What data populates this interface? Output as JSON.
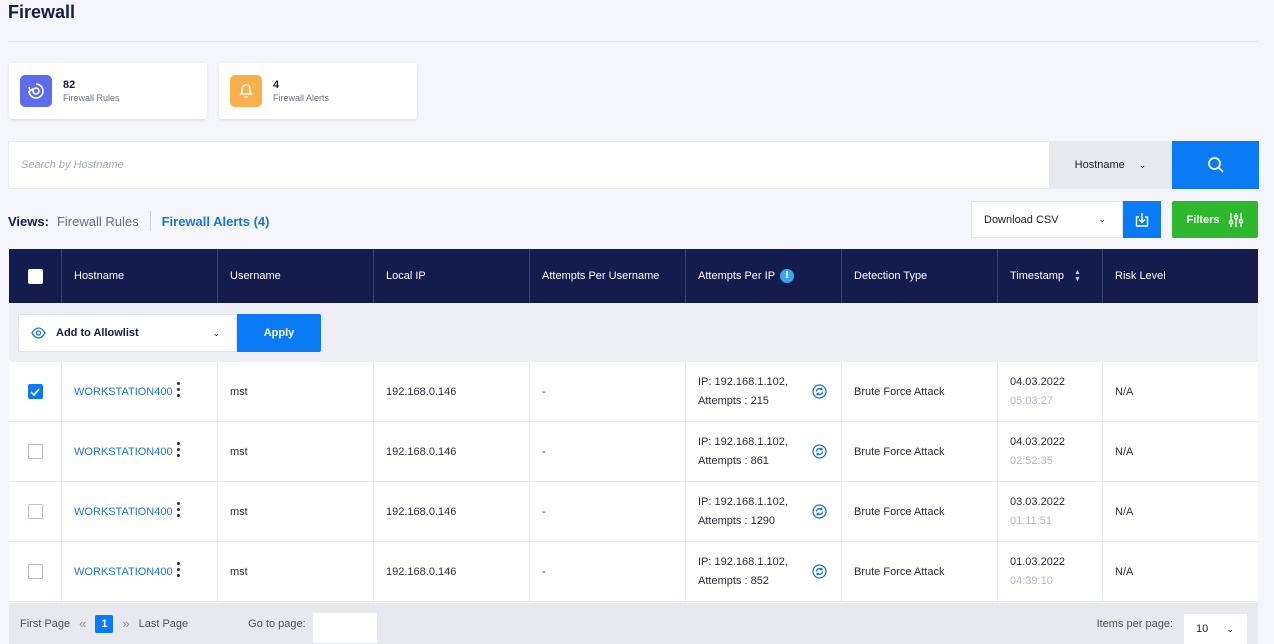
{
  "page": {
    "title": "Firewall"
  },
  "stats": [
    {
      "count": "82",
      "label": "Firewall Rules",
      "icon": "target-icon",
      "color": "#5f6ce9"
    },
    {
      "count": "4",
      "label": "Firewall Alerts",
      "icon": "bell-icon",
      "color": "#f9b04c"
    }
  ],
  "search": {
    "placeholder": "Search by Hostname",
    "field": "Hostname"
  },
  "views": {
    "label": "Views:",
    "tabs": [
      "Firewall Rules",
      "Firewall Alerts (4)"
    ],
    "active": 1
  },
  "toolbar": {
    "download_label": "Download CSV",
    "filters_label": "Filters"
  },
  "table": {
    "columns": [
      "Hostname",
      "Username",
      "Local IP",
      "Attempts Per Username",
      "Attempts Per IP",
      "Detection Type",
      "Timestamp",
      "Risk Level"
    ],
    "bulk_action": "Add to Allowlist",
    "apply_label": "Apply",
    "rows": [
      {
        "checked": true,
        "hostname": "WORKSTATION400",
        "username": "mst",
        "local_ip": "192.168.0.146",
        "attempts_user": "-",
        "ip_line": "IP: 192.168.1.102,",
        "attempts_line": "Attempts : 215",
        "detection": "Brute Force Attack",
        "date": "04.03.2022",
        "time": "05:03:27",
        "risk": "N/A"
      },
      {
        "checked": false,
        "hostname": "WORKSTATION400",
        "username": "mst",
        "local_ip": "192.168.0.146",
        "attempts_user": "-",
        "ip_line": "IP: 192.168.1.102,",
        "attempts_line": "Attempts : 861",
        "detection": "Brute Force Attack",
        "date": "04.03.2022",
        "time": "02:52:35",
        "risk": "N/A"
      },
      {
        "checked": false,
        "hostname": "WORKSTATION400",
        "username": "mst",
        "local_ip": "192.168.0.146",
        "attempts_user": "-",
        "ip_line": "IP: 192.168.1.102,",
        "attempts_line": "Attempts : 1290",
        "detection": "Brute Force Attack",
        "date": "03.03.2022",
        "time": "01:11:51",
        "risk": "N/A"
      },
      {
        "checked": false,
        "hostname": "WORKSTATION400",
        "username": "mst",
        "local_ip": "192.168.0.146",
        "attempts_user": "-",
        "ip_line": "IP: 192.168.1.102,",
        "attempts_line": "Attempts : 852",
        "detection": "Brute Force Attack",
        "date": "01.03.2022",
        "time": "04:39:10",
        "risk": "N/A"
      }
    ]
  },
  "pagination": {
    "first_label": "First Page",
    "current_page": "1",
    "last_label": "Last Page",
    "goto_label": "Go to page:",
    "items_label": "Items per page:",
    "items_value": "10"
  },
  "colors": {
    "accent": "#0a7bf5",
    "header_bg": "#141b4d",
    "link": "#1976d8",
    "filters_green": "#2eb82e"
  }
}
